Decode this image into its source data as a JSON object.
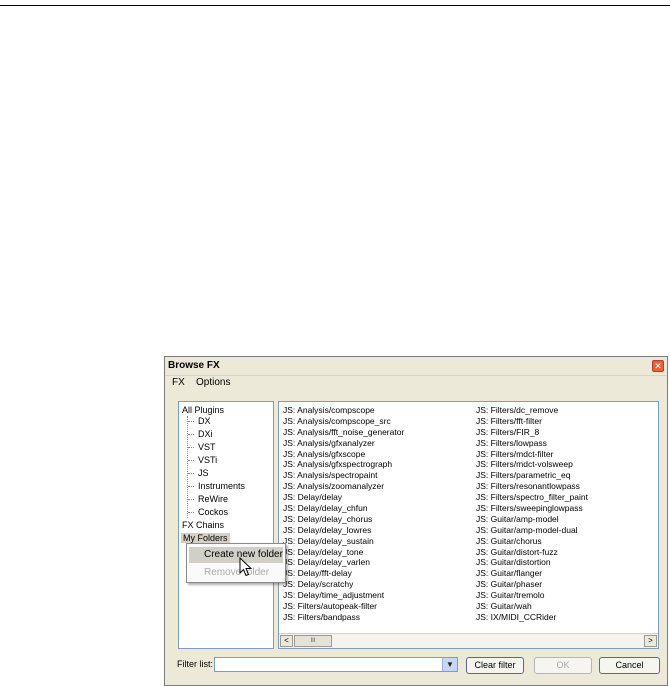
{
  "window": {
    "title": "Browse FX",
    "close_glyph": "✕"
  },
  "menu": {
    "fx": "FX",
    "options": "Options"
  },
  "tree": {
    "all_plugins": "All Plugins",
    "children": [
      "DX",
      "DXi",
      "VST",
      "VSTi",
      "JS",
      "Instruments",
      "ReWire",
      "Cockos"
    ],
    "fx_chains": "FX Chains",
    "my_folders": "My Folders"
  },
  "context_menu": {
    "create_new_folder": "Create new folder",
    "remove_folder": "Remove folder"
  },
  "fx_list": {
    "column_a": [
      "JS: Analysis/compscope",
      "JS: Analysis/compscope_src",
      "JS: Analysis/fft_noise_generator",
      "JS: Analysis/gfxanalyzer",
      "JS: Analysis/gfxscope",
      "JS: Analysis/gfxspectrograph",
      "JS: Analysis/spectropaint",
      "JS: Analysis/zoomanalyzer",
      "JS: Delay/delay",
      "JS: Delay/delay_chfun",
      "JS: Delay/delay_chorus",
      "JS: Delay/delay_lowres",
      "JS: Delay/delay_sustain",
      "JS: Delay/delay_tone",
      "JS: Delay/delay_varlen",
      "JS: Delay/fft-delay",
      "JS: Delay/scratchy",
      "JS: Delay/time_adjustment",
      "JS: Filters/autopeak-filter",
      "JS: Filters/bandpass"
    ],
    "column_b": [
      "JS: Filters/dc_remove",
      "JS: Filters/fft-filter",
      "JS: Filters/FIR_8",
      "JS: Filters/lowpass",
      "JS: Filters/mdct-filter",
      "JS: Filters/mdct-volsweep",
      "JS: Filters/parametric_eq",
      "JS: Filters/resonantlowpass",
      "JS: Filters/spectro_filter_paint",
      "JS: Filters/sweepinglowpass",
      "JS: Guitar/amp-model",
      "JS: Guitar/amp-model-dual",
      "JS: Guitar/chorus",
      "JS: Guitar/distort-fuzz",
      "JS: Guitar/distortion",
      "JS: Guitar/flanger",
      "JS: Guitar/phaser",
      "JS: Guitar/tremolo",
      "JS: Guitar/wah",
      "JS: IX/MIDI_CCRider"
    ]
  },
  "scrollbar": {
    "left_arrow": "<",
    "right_arrow": ">",
    "thumb_grip": "III"
  },
  "filter": {
    "label": "Filter list:",
    "value": "",
    "dropdown_glyph": "▼"
  },
  "buttons": {
    "clear_filter": "Clear filter",
    "ok": "OK",
    "cancel": "Cancel"
  },
  "colors": {
    "window_bg": "#ece9d8",
    "close_button": "#e8603c",
    "panel_border": "#7f9db9",
    "menu_highlight": "#d0cfc8"
  }
}
